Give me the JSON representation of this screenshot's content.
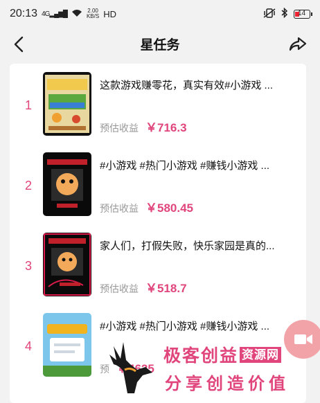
{
  "status_bar": {
    "time": "20:13",
    "signal": "4G",
    "net_speed_value": "2.00",
    "net_speed_unit": "KB/S",
    "hd": "HD",
    "battery": "14"
  },
  "nav": {
    "title": "星任务"
  },
  "tasks": [
    {
      "rank": "1",
      "title": "这款游戏赚零花，真实有效#小游戏 ...",
      "earn_label": "预估收益",
      "amount": "￥716.3"
    },
    {
      "rank": "2",
      "title": "#小游戏 #热门小游戏 #赚钱小游戏 ...",
      "earn_label": "预估收益",
      "amount": "￥580.45"
    },
    {
      "rank": "3",
      "title": "家人们，打假失败，快乐家园是真的...",
      "earn_label": "预估收益",
      "amount": "￥518.7"
    },
    {
      "rank": "4",
      "title": "#小游戏 #热门小游戏 #赚钱小游戏 ...",
      "earn_label": "预",
      "amount": "￥4625"
    }
  ],
  "watermark": {
    "brand_main": "极客创益",
    "brand_tag": "资源网",
    "slogan": "分享创造价值"
  },
  "colors": {
    "accent": "#e0457b",
    "background": "#f2f2f2",
    "card": "#ffffff"
  }
}
